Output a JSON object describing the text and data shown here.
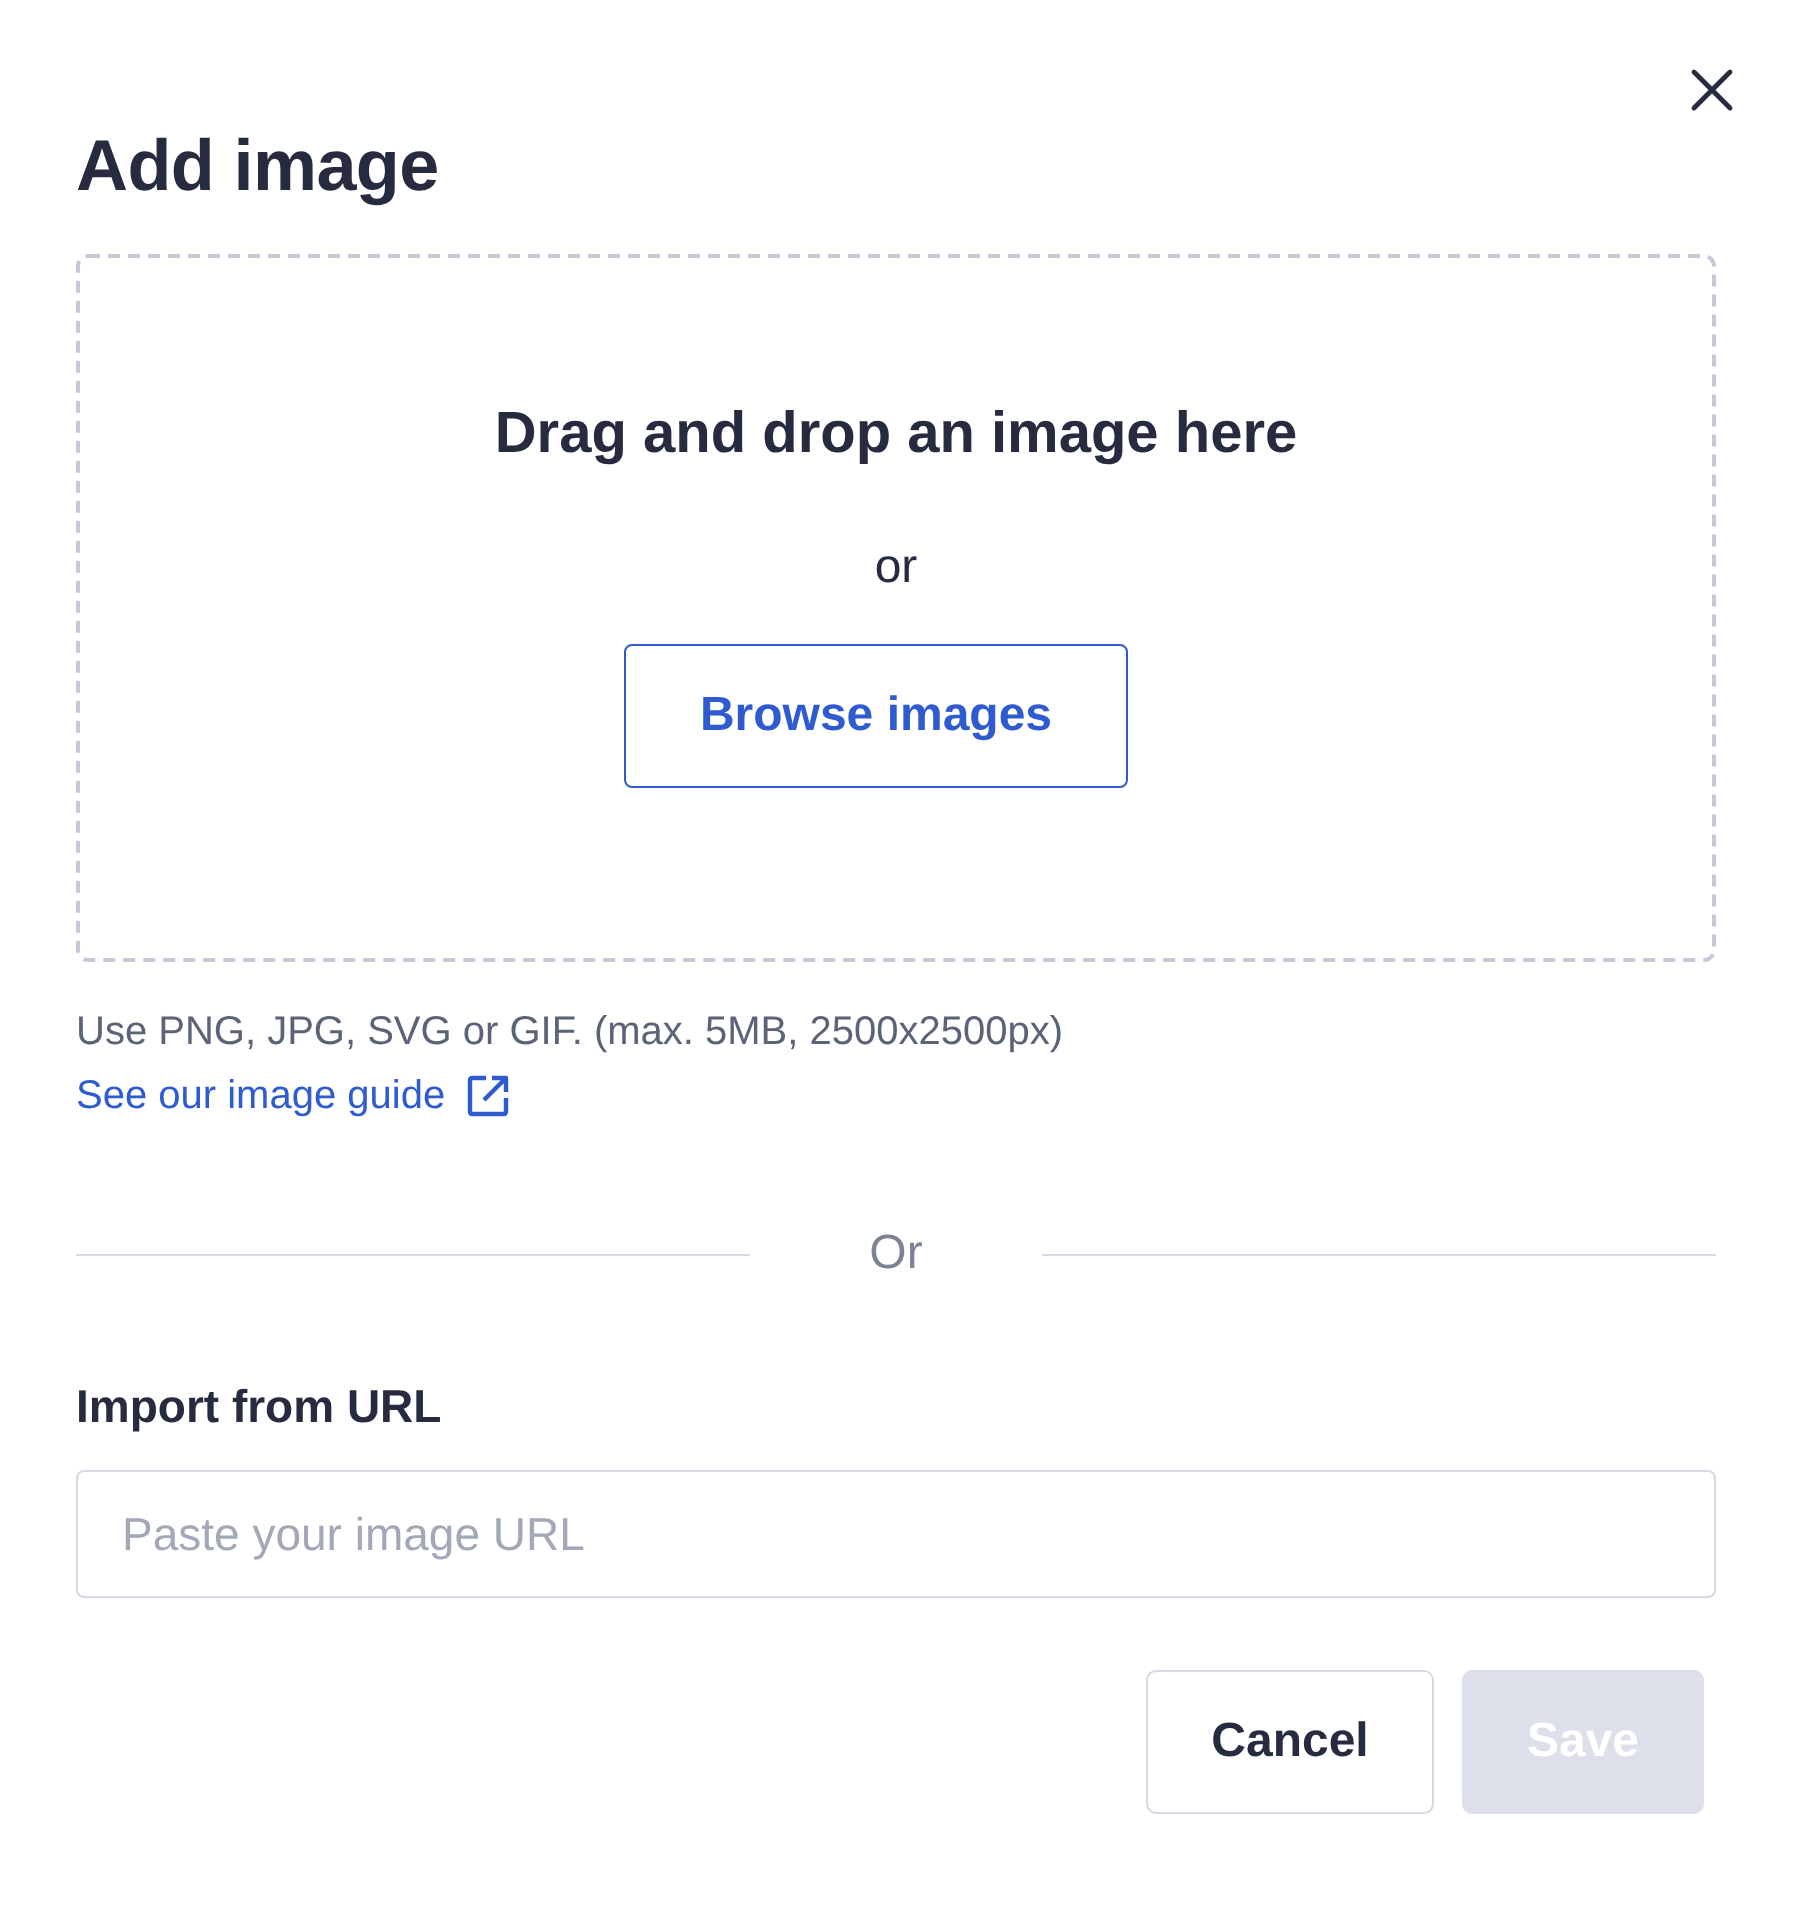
{
  "dialog": {
    "title": "Add image"
  },
  "dropzone": {
    "heading": "Drag and drop an image here",
    "or": "or",
    "browse_button": "Browse images"
  },
  "hint": "Use PNG, JPG, SVG or GIF. (max. 5MB, 2500x2500px)",
  "guide_link": "See our image guide",
  "divider": "Or",
  "url_field": {
    "label": "Import from URL",
    "placeholder": "Paste your image URL"
  },
  "buttons": [
    {
      "label": "Cancel",
      "kind": "secondary",
      "disabled": false
    },
    {
      "label": "Save",
      "kind": "primary",
      "disabled": true
    }
  ]
}
